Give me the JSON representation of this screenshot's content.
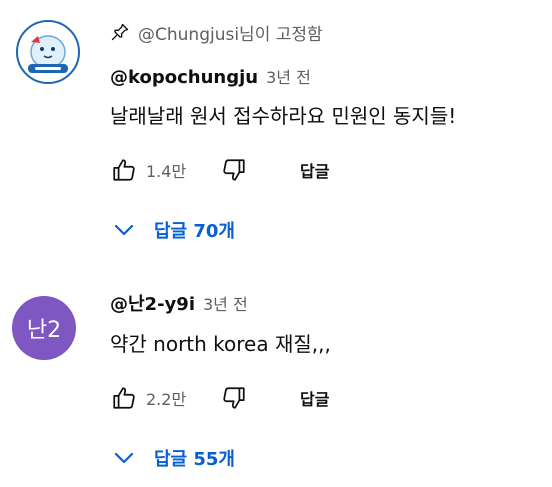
{
  "comments": [
    {
      "pinned_label": "@Chungjusi님이 고정함",
      "author": "@kopochungju",
      "time": "3년 전",
      "text": "날래날래 원서 접수하라요 민원인 동지들!",
      "likes": "1.4만",
      "reply_label": "답글",
      "replies_label": "답글 70개",
      "avatar_icon": "chungju-logo-avatar"
    },
    {
      "author": "@난2-y9i",
      "time": "3년 전",
      "text": "약간 north korea 재질,,,",
      "likes": "2.2만",
      "reply_label": "답글",
      "replies_label": "답글 55개",
      "avatar_initials": "난2"
    }
  ],
  "colors": {
    "link_blue": "#065fd4",
    "secondary_text": "#606060",
    "avatar_purple": "#7e57c2"
  }
}
